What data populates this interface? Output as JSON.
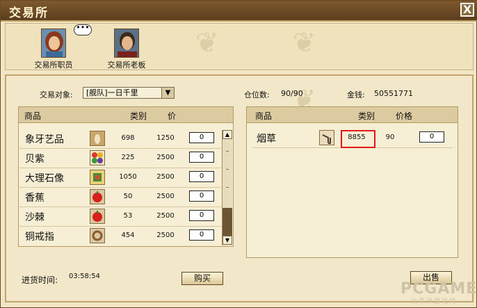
{
  "window": {
    "title": "交易所",
    "close_label": "X"
  },
  "characters": [
    {
      "name": "交易所职员"
    },
    {
      "name": "交易所老板"
    }
  ],
  "speech_bubble": "•••",
  "trade": {
    "target_label": "交易对象:",
    "target_value": "[舰队]一日千里",
    "hold_label": "仓位数:",
    "hold_value": "90/90",
    "money_label": "金钱:",
    "money_value": "50551771"
  },
  "left_panel": {
    "headers": {
      "name": "商品",
      "type": "类别",
      "price": "价"
    },
    "rows": [
      {
        "name": "象牙艺品",
        "type": "698",
        "price": "1250",
        "qty": "0",
        "icon": "ivory-icon"
      },
      {
        "name": "贝紫",
        "type": "225",
        "price": "2500",
        "qty": "0",
        "icon": "dye-icon"
      },
      {
        "name": "大理石像",
        "type": "1050",
        "price": "2500",
        "qty": "0",
        "icon": "statue-icon"
      },
      {
        "name": "香蕉",
        "type": "50",
        "price": "2500",
        "qty": "0",
        "icon": "fruit-icon"
      },
      {
        "name": "沙棘",
        "type": "53",
        "price": "2500",
        "qty": "0",
        "icon": "fruit-icon"
      },
      {
        "name": "铜戒指",
        "type": "454",
        "price": "2500",
        "qty": "0",
        "icon": "ring-icon"
      }
    ]
  },
  "right_panel": {
    "headers": {
      "name": "商品",
      "type": "类别",
      "price": "价格"
    },
    "rows": [
      {
        "name": "烟草",
        "type": "8855",
        "price": "90",
        "qty": "0",
        "icon": "pipe-icon"
      }
    ]
  },
  "footer": {
    "time_label": "进货时间:",
    "time_value": "03:58:54",
    "buy_label": "购买",
    "sell_label": "出售"
  },
  "watermark": {
    "text": "PCGAMES",
    "sub": "太平洋游戏网"
  },
  "colors": {
    "highlight": "#e01818",
    "title_bar": "#6b4a22"
  }
}
